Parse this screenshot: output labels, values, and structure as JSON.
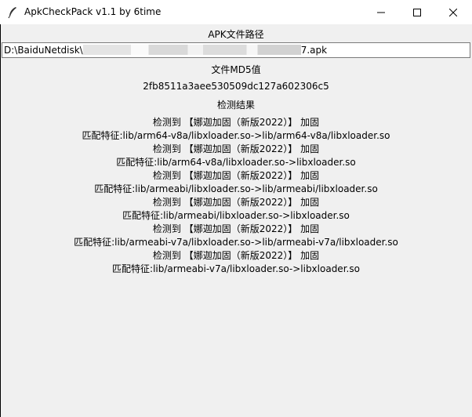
{
  "window": {
    "title": "ApkCheckPack v1.1 by 6time"
  },
  "path_section": {
    "label": "APK文件路径",
    "value_prefix": "D:\\BaiduNetdisk\\",
    "value_suffix": "7.apk"
  },
  "md5_section": {
    "label": "文件MD5值",
    "value": "2fb8511a3aee530509dc127a602306c5"
  },
  "result_section": {
    "label": "检测结果",
    "lines": [
      "检测到 【娜迦加固（新版2022）】 加固",
      "匹配特征:lib/arm64-v8a/libxloader.so->lib/arm64-v8a/libxloader.so",
      "检测到 【娜迦加固（新版2022）】 加固",
      "匹配特征:lib/arm64-v8a/libxloader.so->libxloader.so",
      "检测到 【娜迦加固（新版2022）】 加固",
      "匹配特征:lib/armeabi/libxloader.so->lib/armeabi/libxloader.so",
      "检测到 【娜迦加固（新版2022）】 加固",
      "匹配特征:lib/armeabi/libxloader.so->libxloader.so",
      "检测到 【娜迦加固（新版2022）】 加固",
      "匹配特征:lib/armeabi-v7a/libxloader.so->lib/armeabi-v7a/libxloader.so",
      "检测到 【娜迦加固（新版2022）】 加固",
      "匹配特征:lib/armeabi-v7a/libxloader.so->libxloader.so"
    ]
  },
  "icons": {
    "app": "feather-icon",
    "minimize": "minimize-icon",
    "maximize": "maximize-icon",
    "close": "close-icon"
  }
}
